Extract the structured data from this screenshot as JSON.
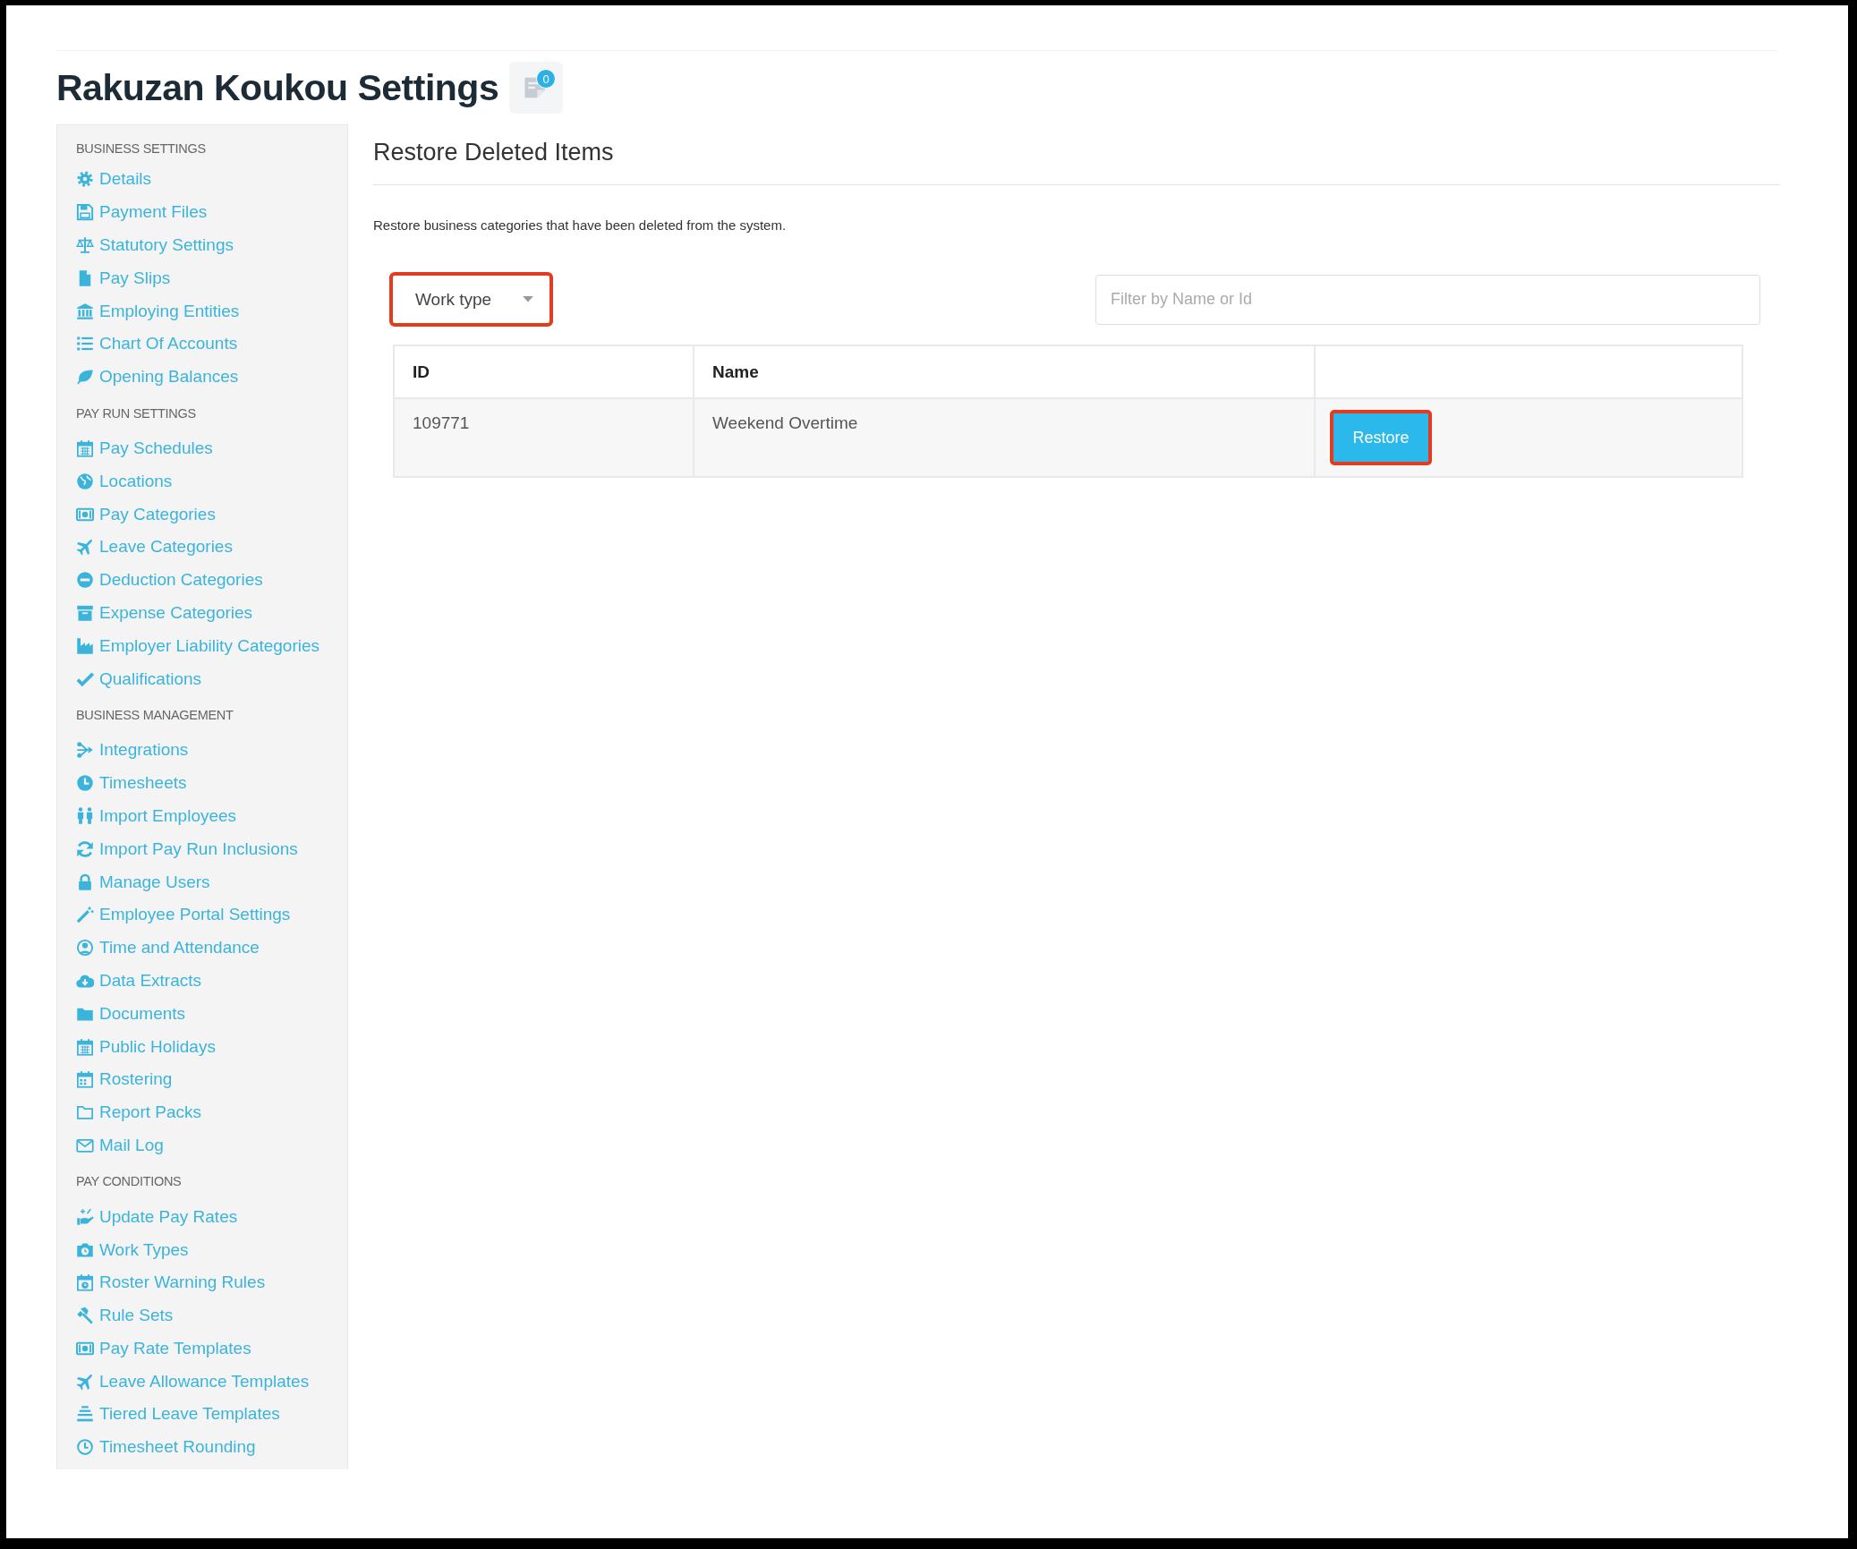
{
  "header": {
    "title": "Rakuzan Koukou Settings",
    "notes_badge": "0"
  },
  "sidebar": {
    "sections": [
      {
        "heading": "BUSINESS SETTINGS",
        "items": [
          {
            "label": "Details"
          },
          {
            "label": "Payment Files"
          },
          {
            "label": "Statutory Settings"
          },
          {
            "label": "Pay Slips"
          },
          {
            "label": "Employing Entities"
          },
          {
            "label": "Chart Of Accounts"
          },
          {
            "label": "Opening Balances"
          }
        ]
      },
      {
        "heading": "PAY RUN SETTINGS",
        "items": [
          {
            "label": "Pay Schedules"
          },
          {
            "label": "Locations"
          },
          {
            "label": "Pay Categories"
          },
          {
            "label": "Leave Categories"
          },
          {
            "label": "Deduction Categories"
          },
          {
            "label": "Expense Categories"
          },
          {
            "label": "Employer Liability Categories"
          },
          {
            "label": "Qualifications"
          }
        ]
      },
      {
        "heading": "BUSINESS MANAGEMENT",
        "items": [
          {
            "label": "Integrations"
          },
          {
            "label": "Timesheets"
          },
          {
            "label": "Import Employees"
          },
          {
            "label": "Import Pay Run Inclusions"
          },
          {
            "label": "Manage Users"
          },
          {
            "label": "Employee Portal Settings"
          },
          {
            "label": "Time and Attendance"
          },
          {
            "label": "Data Extracts"
          },
          {
            "label": "Documents"
          },
          {
            "label": "Public Holidays"
          },
          {
            "label": "Rostering"
          },
          {
            "label": "Report Packs"
          },
          {
            "label": "Mail Log"
          }
        ]
      },
      {
        "heading": "PAY CONDITIONS",
        "items": [
          {
            "label": "Update Pay Rates"
          },
          {
            "label": "Work Types"
          },
          {
            "label": "Roster Warning Rules"
          },
          {
            "label": "Rule Sets"
          },
          {
            "label": "Pay Rate Templates"
          },
          {
            "label": "Leave Allowance Templates"
          },
          {
            "label": "Tiered Leave Templates"
          },
          {
            "label": "Timesheet Rounding"
          }
        ]
      }
    ]
  },
  "main": {
    "heading": "Restore Deleted Items",
    "description": "Restore business categories that have been deleted from the system.",
    "type_select": {
      "value": "Work type",
      "highlighted": true
    },
    "filter": {
      "placeholder": "Filter by Name or Id"
    },
    "table": {
      "columns": [
        "ID",
        "Name"
      ],
      "rows": [
        {
          "cells": [
            "109771",
            "Weekend Overtime"
          ],
          "action": {
            "label": "Restore",
            "highlighted": true
          }
        }
      ]
    }
  }
}
